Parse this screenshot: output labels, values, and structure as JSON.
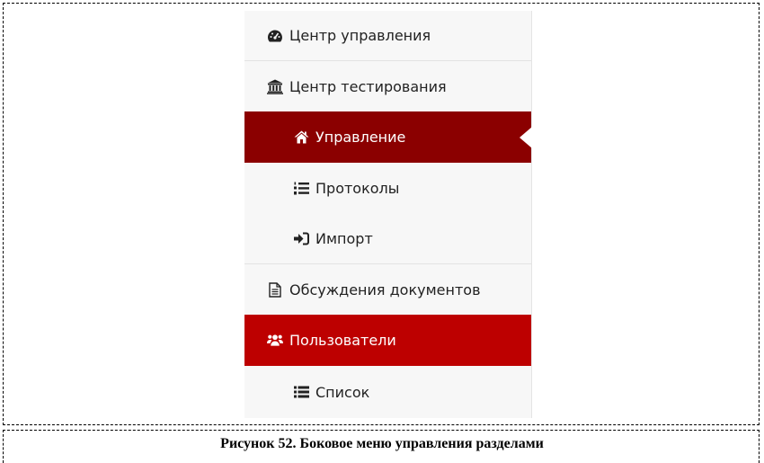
{
  "menu": {
    "items": [
      {
        "label": "Центр управления",
        "icon": "dashboard-icon"
      },
      {
        "label": "Центр тестирования",
        "icon": "institution-icon"
      },
      {
        "label": "Управление",
        "icon": "home-icon",
        "state": "active"
      },
      {
        "label": "Протоколы",
        "icon": "ordered-list-icon"
      },
      {
        "label": "Импорт",
        "icon": "sign-in-icon"
      },
      {
        "label": "Обсуждения документов",
        "icon": "document-icon"
      },
      {
        "label": "Пользователи",
        "icon": "users-icon",
        "state": "expanded"
      },
      {
        "label": "Список",
        "icon": "list-icon"
      }
    ]
  },
  "colors": {
    "active_dark": "#8b0000",
    "active_red": "#bd0000",
    "menu_bg": "#f7f7f7"
  },
  "caption": "Рисунок 52. Боковое меню управления разделами"
}
